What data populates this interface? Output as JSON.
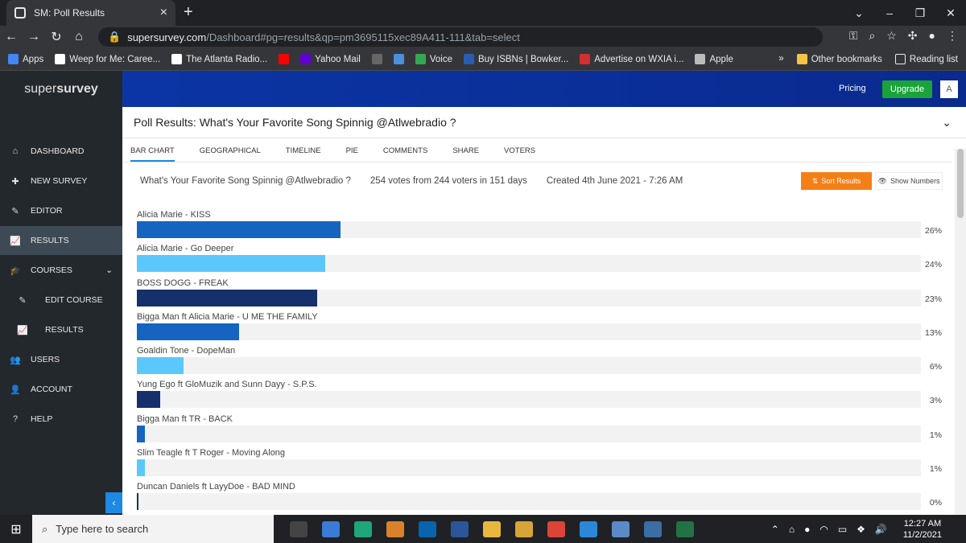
{
  "browser": {
    "tab_title": "SM: Poll Results",
    "url_domain": "supersurvey.com",
    "url_path": "/Dashboard#pg=results&qp=pm3695115xec89A411-111&tab=select",
    "bookmarks": [
      {
        "label": "Apps",
        "color": "#4285f4"
      },
      {
        "label": "Weep for Me: Caree...",
        "color": "#ffffff"
      },
      {
        "label": "The Atlanta Radio...",
        "color": "#ffffff"
      },
      {
        "label": "",
        "color": "#ff0000"
      },
      {
        "label": "Yahoo Mail",
        "color": "#6001d2"
      },
      {
        "label": "",
        "color": "#666666"
      },
      {
        "label": "",
        "color": "#4a90d9"
      },
      {
        "label": "Voice",
        "color": "#34a853"
      },
      {
        "label": "Buy ISBNs | Bowker...",
        "color": "#2a5db0"
      },
      {
        "label": "Advertise on WXIA i...",
        "color": "#d32f2f"
      },
      {
        "label": "Apple",
        "color": "#bbbbbb"
      }
    ],
    "other_bookmarks": "Other bookmarks",
    "reading_list": "Reading list"
  },
  "app": {
    "logo_a": "super",
    "logo_b": "survey",
    "pricing": "Pricing",
    "upgrade": "Upgrade",
    "avatar": "A"
  },
  "sidebar": {
    "items": [
      {
        "label": "DASHBOARD",
        "icon": "home-icon"
      },
      {
        "label": "NEW SURVEY",
        "icon": "plus-icon"
      },
      {
        "label": "EDITOR",
        "icon": "pencil-icon"
      },
      {
        "label": "RESULTS",
        "icon": "chart-icon"
      },
      {
        "label": "COURSES",
        "icon": "graduation-cap-icon"
      },
      {
        "label": "EDIT COURSE",
        "icon": "pencil-icon"
      },
      {
        "label": "RESULTS",
        "icon": "chart-icon"
      },
      {
        "label": "USERS",
        "icon": "users-icon"
      },
      {
        "label": "ACCOUNT",
        "icon": "user-icon"
      },
      {
        "label": "HELP",
        "icon": "help-icon"
      }
    ]
  },
  "page": {
    "title": "Poll Results: What's Your Favorite Song Spinnig @Atlwebradio ?",
    "tabs": [
      "BAR CHART",
      "GEOGRAPHICAL",
      "TIMELINE",
      "PIE",
      "COMMENTS",
      "SHARE",
      "VOTERS"
    ],
    "question": "What's Your Favorite Song Spinnig @Atlwebradio ?",
    "votes": "254 votes from 244 voters in 151 days",
    "created": "Created 4th June 2021 - 7:26 AM",
    "sort_results": "Sort Results",
    "show_numbers": "Show Numbers"
  },
  "chart_data": {
    "type": "bar",
    "categories": [
      "Alicia Marie - KISS",
      "Alicia Marie - Go Deeper",
      "BOSS DOGG - FREAK",
      "Bigga Man ft Alicia Marie - U ME THE FAMILY",
      "Goaldin Tone - DopeMan",
      "Yung Ego ft GloMuzik and Sunn Dayy - S.P.S.",
      "Bigga Man ft TR - BACK",
      "Slim Teagle ft T Roger - Moving Along",
      "Duncan Daniels ft LayyDoe - BAD MIND"
    ],
    "values": [
      26,
      24,
      23,
      13,
      6,
      3,
      1,
      1,
      0
    ],
    "labels": [
      "26%",
      "24%",
      "23%",
      "13%",
      "6%",
      "3%",
      "1%",
      "1%",
      "0%"
    ],
    "colors": [
      "#1565c0",
      "#5bc8fb",
      "#15306b",
      "#1565c0",
      "#5bc8fb",
      "#15306b",
      "#1565c0",
      "#5bc8fb",
      "#15306b"
    ],
    "ylim": [
      0,
      100
    ]
  },
  "taskbar": {
    "search_placeholder": "Type here to search",
    "time": "12:27 AM",
    "date": "11/2/2021"
  }
}
